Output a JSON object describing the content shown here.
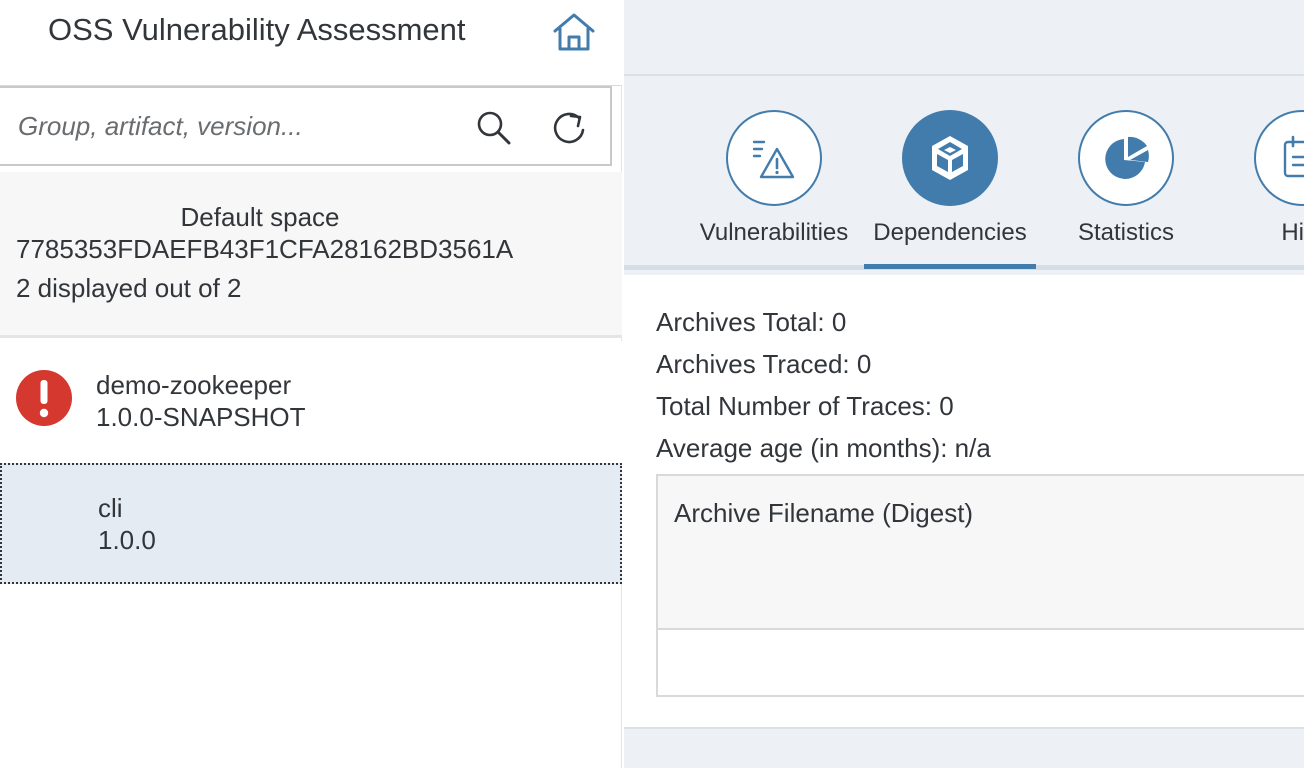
{
  "app": {
    "title": "OSS Vulnerability Assessment"
  },
  "search": {
    "placeholder": "Group, artifact, version...",
    "value": ""
  },
  "space": {
    "name": "Default space",
    "token": "7785353FDAEFB43F1CFA28162BD3561A",
    "count_text": "2 displayed out of 2"
  },
  "apps": [
    {
      "name": "demo-zookeeper",
      "version": "1.0.0-SNAPSHOT",
      "status_icon": "error-icon",
      "selected": false
    },
    {
      "name": "cli",
      "version": "1.0.0",
      "status_icon": "",
      "selected": true
    }
  ],
  "tabs": [
    {
      "label": "Vulnerabilities",
      "icon": "vulnerabilities-list-warning-icon",
      "selected": false
    },
    {
      "label": "Dependencies",
      "icon": "dependencies-cubes-icon",
      "selected": true
    },
    {
      "label": "Statistics",
      "icon": "pie-chart-icon",
      "selected": false
    },
    {
      "label": "Hist",
      "icon": "history-calendar-icon",
      "selected": false
    }
  ],
  "dependencies": {
    "stats": [
      "Archives Total: 0",
      "Archives Traced: 0",
      "Total Number of Traces: 0",
      "Average age (in months): n/a"
    ],
    "table": {
      "columns": [
        "Archive Filename (Digest)"
      ],
      "rows": []
    }
  },
  "colors": {
    "accent": "#427cac",
    "error": "#d5382f",
    "selected_row": "#e5ebf3",
    "detail_background": "#edf1f6",
    "text": "#32363a"
  }
}
